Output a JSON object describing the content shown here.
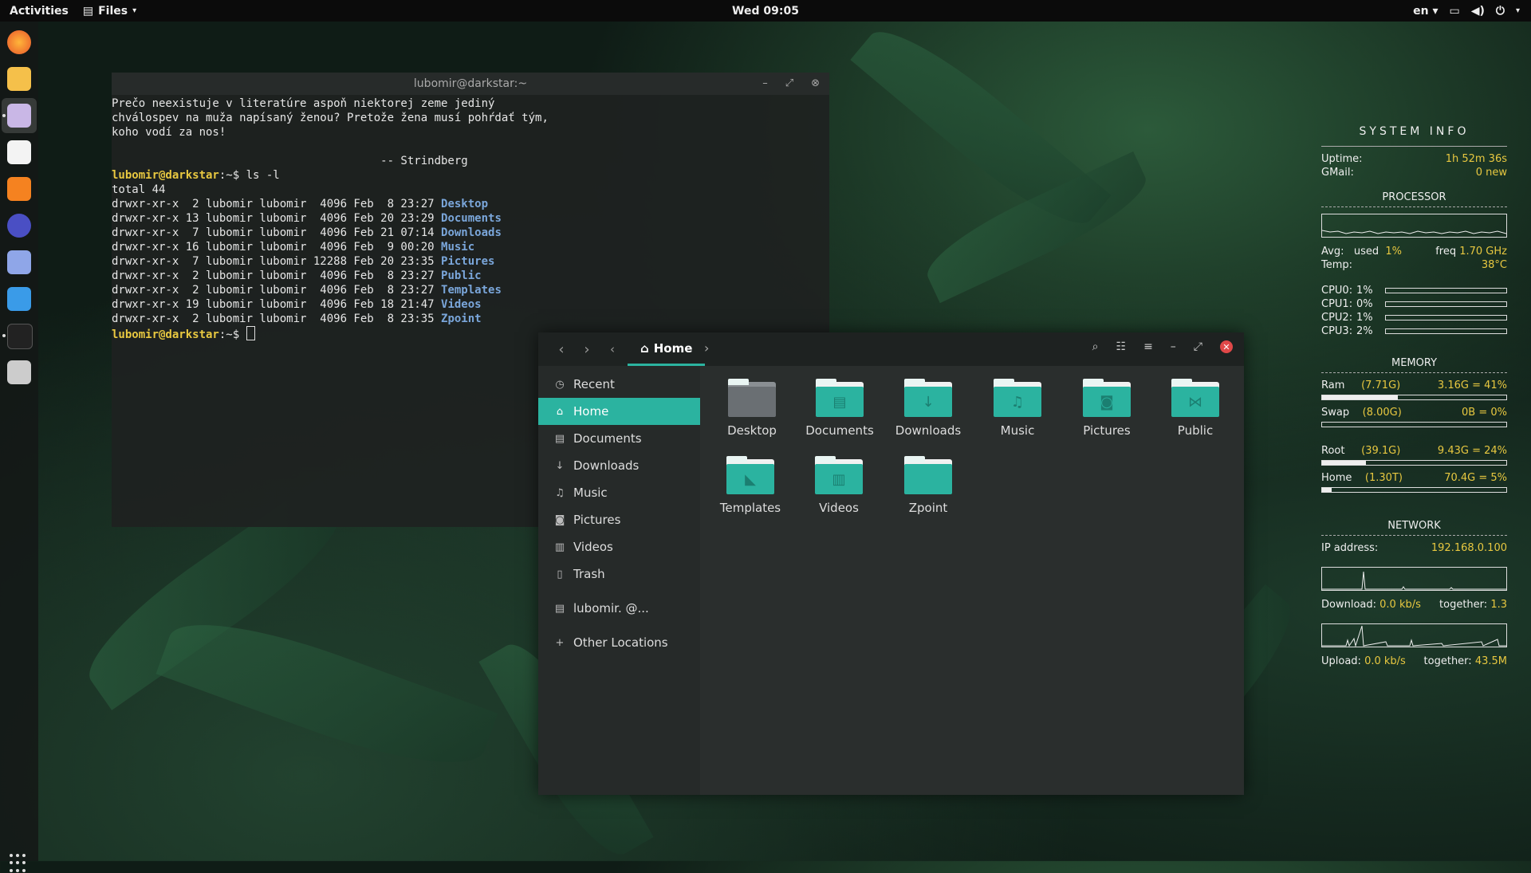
{
  "topbar": {
    "activities": "Activities",
    "app_name": "Files",
    "clock": "Wed 09:05",
    "lang": "en"
  },
  "terminal": {
    "title": "lubomir@darkstar:~",
    "quote_lines": [
      "Prečo neexistuje v literatúre aspoň niektorej zeme jediný",
      "chválospev na muža napísaný ženou? Pretože žena musí pohŕdať tým,",
      "koho vodí za nos!"
    ],
    "quote_author": "                                        -- Strindberg",
    "prompt": "lubomir@darkstar",
    "prompt_suffix": ":~$ ",
    "command": "ls -l",
    "total": "total 44",
    "listing": [
      {
        "meta": "drwxr-xr-x  2 lubomir lubomir  4096 Feb  8 23:27 ",
        "name": "Desktop"
      },
      {
        "meta": "drwxr-xr-x 13 lubomir lubomir  4096 Feb 20 23:29 ",
        "name": "Documents"
      },
      {
        "meta": "drwxr-xr-x  7 lubomir lubomir  4096 Feb 21 07:14 ",
        "name": "Downloads"
      },
      {
        "meta": "drwxr-xr-x 16 lubomir lubomir  4096 Feb  9 00:20 ",
        "name": "Music"
      },
      {
        "meta": "drwxr-xr-x  7 lubomir lubomir 12288 Feb 20 23:35 ",
        "name": "Pictures"
      },
      {
        "meta": "drwxr-xr-x  2 lubomir lubomir  4096 Feb  8 23:27 ",
        "name": "Public"
      },
      {
        "meta": "drwxr-xr-x  2 lubomir lubomir  4096 Feb  8 23:27 ",
        "name": "Templates"
      },
      {
        "meta": "drwxr-xr-x 19 lubomir lubomir  4096 Feb 18 21:47 ",
        "name": "Videos"
      },
      {
        "meta": "drwxr-xr-x  2 lubomir lubomir  4096 Feb  8 23:35 ",
        "name": "Zpoint"
      }
    ]
  },
  "files": {
    "breadcrumb": "Home",
    "sidebar": [
      {
        "label": "Recent",
        "icon": "clock-icon",
        "glyph": "◷"
      },
      {
        "label": "Home",
        "icon": "home-icon",
        "glyph": "⌂",
        "active": true
      },
      {
        "label": "Documents",
        "icon": "document-icon",
        "glyph": "▤"
      },
      {
        "label": "Downloads",
        "icon": "download-icon",
        "glyph": "↓"
      },
      {
        "label": "Music",
        "icon": "music-icon",
        "glyph": "♫"
      },
      {
        "label": "Pictures",
        "icon": "camera-icon",
        "glyph": "◙"
      },
      {
        "label": "Videos",
        "icon": "film-icon",
        "glyph": "▥"
      },
      {
        "label": "Trash",
        "icon": "trash-icon",
        "glyph": "▯"
      },
      {
        "label": "lubomir.        @...",
        "icon": "network-drive-icon",
        "glyph": "▤"
      },
      {
        "label": "Other Locations",
        "icon": "plus-icon",
        "glyph": "+"
      }
    ],
    "folders": [
      {
        "label": "Desktop",
        "glyph": ""
      },
      {
        "label": "Documents",
        "glyph": "▤"
      },
      {
        "label": "Downloads",
        "glyph": "↓"
      },
      {
        "label": "Music",
        "glyph": "♫"
      },
      {
        "label": "Pictures",
        "glyph": "◙"
      },
      {
        "label": "Public",
        "glyph": "⋈"
      },
      {
        "label": "Templates",
        "glyph": "◣"
      },
      {
        "label": "Videos",
        "glyph": "▥"
      },
      {
        "label": "Zpoint",
        "glyph": ""
      }
    ]
  },
  "conky": {
    "title": "SYSTEM INFO",
    "uptime_label": "Uptime:",
    "uptime": "1h 52m 36s",
    "gmail_label": "GMail:",
    "gmail": "0 new",
    "processor_title": "PROCESSOR",
    "avg_label": "Avg:",
    "used_label": "used",
    "used": "1%",
    "freq_label": "freq",
    "freq": "1.70 GHz",
    "temp_label": "Temp:",
    "temp": "38°C",
    "cpus": [
      {
        "label": "CPU0:",
        "pct": "1%",
        "fill": 0.01
      },
      {
        "label": "CPU1:",
        "pct": "0%",
        "fill": 0.0
      },
      {
        "label": "CPU2:",
        "pct": "1%",
        "fill": 0.01
      },
      {
        "label": "CPU3:",
        "pct": "2%",
        "fill": 0.02
      }
    ],
    "memory_title": "MEMORY",
    "ram_label": "Ram",
    "ram_total": "(7.71G)",
    "ram_used": "3.16G = 41%",
    "ram_fill": 0.41,
    "swap_label": "Swap",
    "swap_total": "(8.00G)",
    "swap_used": "0B = 0%",
    "swap_fill": 0.0,
    "root_label": "Root",
    "root_total": "(39.1G)",
    "root_used": "9.43G = 24%",
    "root_fill": 0.24,
    "home_label": "Home",
    "home_total": "(1.30T)",
    "home_used": "70.4G = 5%",
    "home_fill": 0.05,
    "network_title": "NETWORK",
    "ip_label": "IP address:",
    "ip": "192.168.0.100",
    "download_label": "Download:",
    "download": "0.0 kb/s",
    "down_together_label": "together:",
    "down_together": "1.3",
    "upload_label": "Upload:",
    "upload": "0.0 kb/s",
    "up_together_label": "together:",
    "up_together": "43.5M"
  },
  "colors": {
    "accent": "#2bb3a0",
    "prompt": "#e8c840",
    "dir": "#7aa6da"
  }
}
